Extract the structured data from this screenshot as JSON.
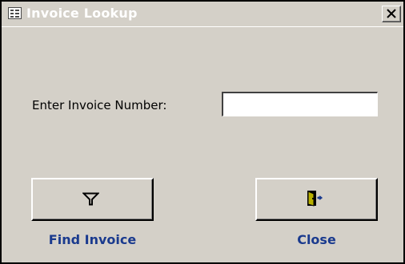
{
  "window": {
    "title": "Invoice Lookup",
    "title_icon": "form-icon",
    "close_icon": "close-icon",
    "colors": {
      "face": "#d4d0c8",
      "caption_text": "#1a3a8e"
    }
  },
  "form": {
    "invoice_label": "Enter Invoice Number:",
    "invoice_value": "",
    "invoice_placeholder": ""
  },
  "buttons": {
    "find": {
      "caption": "Find Invoice",
      "icon": "filter-icon"
    },
    "close": {
      "caption": "Close",
      "icon": "exit-door-icon"
    }
  }
}
